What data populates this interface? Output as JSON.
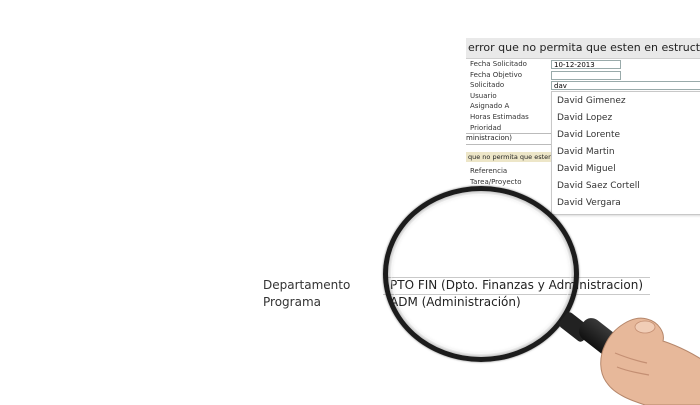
{
  "form": {
    "title": "error que no permita que esten en estructuras codi",
    "labels": [
      "Fecha Solicitado",
      "Fecha Objetivo",
      "Solicitado",
      "Usuario",
      "Asignado A",
      "Horas Estimadas",
      "Prioridad"
    ],
    "fecha_solicitado_value": "10-12-2013",
    "solicitado_value": "dav",
    "program_strip": "ministracion)",
    "yellow_strip": "que no permita que esten",
    "labels2": [
      "Referencia",
      "Tarea/Proyecto"
    ]
  },
  "dropdown": {
    "items": [
      "David Gimenez",
      "David Lopez",
      "David Lorente",
      "David Martin",
      "David Miguel",
      "David Saez Cortell",
      "David Vergara"
    ]
  },
  "details": {
    "departamento_label": "Departamento",
    "departamento_value": "PTO FIN (Dpto. Finanzas y Administracion)",
    "programa_label": "Programa",
    "programa_value": "ADM (Administración)"
  },
  "icons": [
    "magnifying-glass-icon",
    "hand-icon"
  ]
}
